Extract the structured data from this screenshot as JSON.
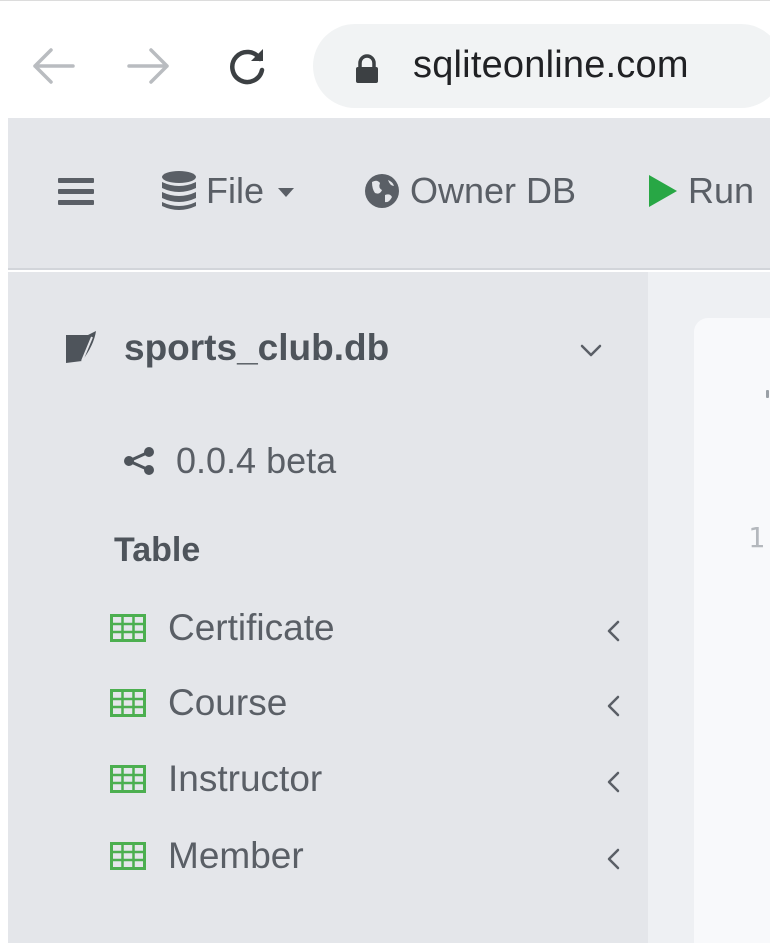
{
  "browser": {
    "url": "sqliteonline.com"
  },
  "navbar": {
    "file_label": "File",
    "owner_label": "Owner DB",
    "run_label": "Run"
  },
  "sidebar": {
    "db_name": "sports_club.db",
    "version": "0.0.4 beta",
    "section_title": "Table",
    "tables": [
      {
        "label": "Certificate"
      },
      {
        "label": "Course"
      },
      {
        "label": "Instructor"
      },
      {
        "label": "Member"
      }
    ]
  },
  "editor": {
    "line_number": "1"
  },
  "colors": {
    "run_accent": "#28a745",
    "table_icon": "#4caf50"
  }
}
